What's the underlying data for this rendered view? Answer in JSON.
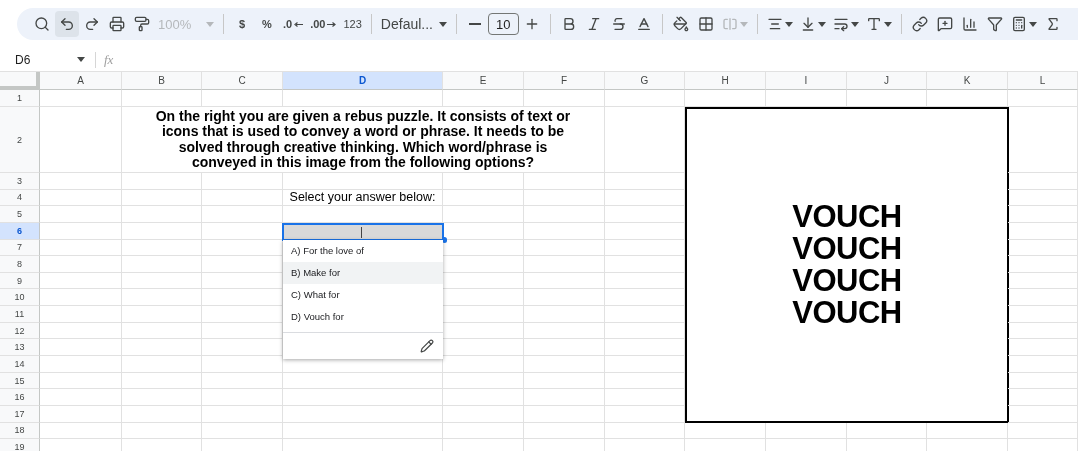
{
  "toolbar": {
    "zoom": {
      "value": "100%",
      "disabled": true
    },
    "currency": "$",
    "percent": "%",
    "decrease_decimal": ".0",
    "increase_decimal": ".00",
    "number_format": "123",
    "font": "Defaul...",
    "font_size": "10"
  },
  "formula_bar": {
    "cell_ref": "D6",
    "fx": "fx"
  },
  "columns": [
    {
      "label": "A",
      "selected": false
    },
    {
      "label": "B",
      "selected": false
    },
    {
      "label": "C",
      "selected": false
    },
    {
      "label": "D",
      "selected": true
    },
    {
      "label": "E",
      "selected": false
    },
    {
      "label": "F",
      "selected": false
    },
    {
      "label": "G",
      "selected": false
    },
    {
      "label": "H",
      "selected": false
    },
    {
      "label": "I",
      "selected": false
    },
    {
      "label": "J",
      "selected": false
    },
    {
      "label": "K",
      "selected": false
    },
    {
      "label": "L",
      "selected": false
    }
  ],
  "rows": [
    {
      "label": "1",
      "selected": false
    },
    {
      "label": "2",
      "selected": false
    },
    {
      "label": "3",
      "selected": false
    },
    {
      "label": "4",
      "selected": false
    },
    {
      "label": "5",
      "selected": false
    },
    {
      "label": "6",
      "selected": true
    },
    {
      "label": "7",
      "selected": false
    },
    {
      "label": "8",
      "selected": false
    },
    {
      "label": "9",
      "selected": false
    },
    {
      "label": "10",
      "selected": false
    },
    {
      "label": "11",
      "selected": false
    },
    {
      "label": "12",
      "selected": false
    },
    {
      "label": "13",
      "selected": false
    },
    {
      "label": "14",
      "selected": false
    },
    {
      "label": "15",
      "selected": false
    },
    {
      "label": "16",
      "selected": false
    },
    {
      "label": "17",
      "selected": false
    },
    {
      "label": "18",
      "selected": false
    },
    {
      "label": "19",
      "selected": false
    }
  ],
  "question": "On the right you are given a rebus puzzle. It consists of text or icons that is used to convey a word or phrase. It needs to be solved through creative thinking. Which word/phrase is conveyed in this image from the following options?",
  "prompt": "Select your answer below:",
  "dropdown": {
    "options": [
      {
        "label": "A) For the love of",
        "highlighted": false
      },
      {
        "label": "B) Make for",
        "highlighted": true
      },
      {
        "label": "C) What for",
        "highlighted": false
      },
      {
        "label": "D) Vouch for",
        "highlighted": false
      }
    ]
  },
  "rebus": {
    "lines": [
      "VOUCH",
      "VOUCH",
      "VOUCH",
      "VOUCH"
    ]
  }
}
